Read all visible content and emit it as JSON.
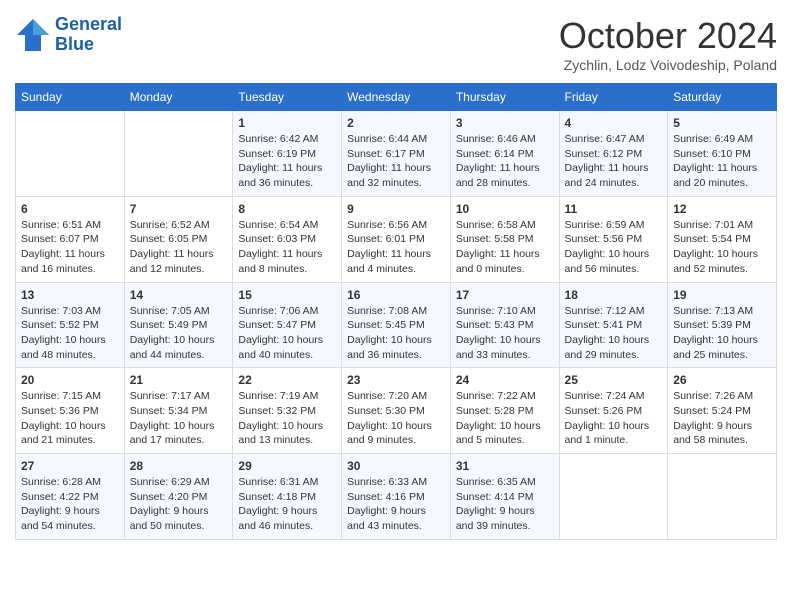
{
  "header": {
    "logo_line1": "General",
    "logo_line2": "Blue",
    "month_title": "October 2024",
    "subtitle": "Zychlin, Lodz Voivodeship, Poland"
  },
  "days_of_week": [
    "Sunday",
    "Monday",
    "Tuesday",
    "Wednesday",
    "Thursday",
    "Friday",
    "Saturday"
  ],
  "weeks": [
    [
      {
        "day": "",
        "content": ""
      },
      {
        "day": "",
        "content": ""
      },
      {
        "day": "1",
        "content": "Sunrise: 6:42 AM\nSunset: 6:19 PM\nDaylight: 11 hours\nand 36 minutes."
      },
      {
        "day": "2",
        "content": "Sunrise: 6:44 AM\nSunset: 6:17 PM\nDaylight: 11 hours\nand 32 minutes."
      },
      {
        "day": "3",
        "content": "Sunrise: 6:46 AM\nSunset: 6:14 PM\nDaylight: 11 hours\nand 28 minutes."
      },
      {
        "day": "4",
        "content": "Sunrise: 6:47 AM\nSunset: 6:12 PM\nDaylight: 11 hours\nand 24 minutes."
      },
      {
        "day": "5",
        "content": "Sunrise: 6:49 AM\nSunset: 6:10 PM\nDaylight: 11 hours\nand 20 minutes."
      }
    ],
    [
      {
        "day": "6",
        "content": "Sunrise: 6:51 AM\nSunset: 6:07 PM\nDaylight: 11 hours\nand 16 minutes."
      },
      {
        "day": "7",
        "content": "Sunrise: 6:52 AM\nSunset: 6:05 PM\nDaylight: 11 hours\nand 12 minutes."
      },
      {
        "day": "8",
        "content": "Sunrise: 6:54 AM\nSunset: 6:03 PM\nDaylight: 11 hours\nand 8 minutes."
      },
      {
        "day": "9",
        "content": "Sunrise: 6:56 AM\nSunset: 6:01 PM\nDaylight: 11 hours\nand 4 minutes."
      },
      {
        "day": "10",
        "content": "Sunrise: 6:58 AM\nSunset: 5:58 PM\nDaylight: 11 hours\nand 0 minutes."
      },
      {
        "day": "11",
        "content": "Sunrise: 6:59 AM\nSunset: 5:56 PM\nDaylight: 10 hours\nand 56 minutes."
      },
      {
        "day": "12",
        "content": "Sunrise: 7:01 AM\nSunset: 5:54 PM\nDaylight: 10 hours\nand 52 minutes."
      }
    ],
    [
      {
        "day": "13",
        "content": "Sunrise: 7:03 AM\nSunset: 5:52 PM\nDaylight: 10 hours\nand 48 minutes."
      },
      {
        "day": "14",
        "content": "Sunrise: 7:05 AM\nSunset: 5:49 PM\nDaylight: 10 hours\nand 44 minutes."
      },
      {
        "day": "15",
        "content": "Sunrise: 7:06 AM\nSunset: 5:47 PM\nDaylight: 10 hours\nand 40 minutes."
      },
      {
        "day": "16",
        "content": "Sunrise: 7:08 AM\nSunset: 5:45 PM\nDaylight: 10 hours\nand 36 minutes."
      },
      {
        "day": "17",
        "content": "Sunrise: 7:10 AM\nSunset: 5:43 PM\nDaylight: 10 hours\nand 33 minutes."
      },
      {
        "day": "18",
        "content": "Sunrise: 7:12 AM\nSunset: 5:41 PM\nDaylight: 10 hours\nand 29 minutes."
      },
      {
        "day": "19",
        "content": "Sunrise: 7:13 AM\nSunset: 5:39 PM\nDaylight: 10 hours\nand 25 minutes."
      }
    ],
    [
      {
        "day": "20",
        "content": "Sunrise: 7:15 AM\nSunset: 5:36 PM\nDaylight: 10 hours\nand 21 minutes."
      },
      {
        "day": "21",
        "content": "Sunrise: 7:17 AM\nSunset: 5:34 PM\nDaylight: 10 hours\nand 17 minutes."
      },
      {
        "day": "22",
        "content": "Sunrise: 7:19 AM\nSunset: 5:32 PM\nDaylight: 10 hours\nand 13 minutes."
      },
      {
        "day": "23",
        "content": "Sunrise: 7:20 AM\nSunset: 5:30 PM\nDaylight: 10 hours\nand 9 minutes."
      },
      {
        "day": "24",
        "content": "Sunrise: 7:22 AM\nSunset: 5:28 PM\nDaylight: 10 hours\nand 5 minutes."
      },
      {
        "day": "25",
        "content": "Sunrise: 7:24 AM\nSunset: 5:26 PM\nDaylight: 10 hours\nand 1 minute."
      },
      {
        "day": "26",
        "content": "Sunrise: 7:26 AM\nSunset: 5:24 PM\nDaylight: 9 hours\nand 58 minutes."
      }
    ],
    [
      {
        "day": "27",
        "content": "Sunrise: 6:28 AM\nSunset: 4:22 PM\nDaylight: 9 hours\nand 54 minutes."
      },
      {
        "day": "28",
        "content": "Sunrise: 6:29 AM\nSunset: 4:20 PM\nDaylight: 9 hours\nand 50 minutes."
      },
      {
        "day": "29",
        "content": "Sunrise: 6:31 AM\nSunset: 4:18 PM\nDaylight: 9 hours\nand 46 minutes."
      },
      {
        "day": "30",
        "content": "Sunrise: 6:33 AM\nSunset: 4:16 PM\nDaylight: 9 hours\nand 43 minutes."
      },
      {
        "day": "31",
        "content": "Sunrise: 6:35 AM\nSunset: 4:14 PM\nDaylight: 9 hours\nand 39 minutes."
      },
      {
        "day": "",
        "content": ""
      },
      {
        "day": "",
        "content": ""
      }
    ]
  ]
}
